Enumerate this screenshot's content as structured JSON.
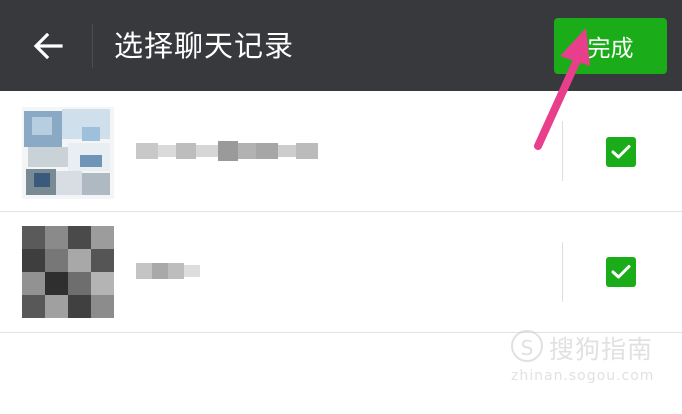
{
  "header": {
    "back_icon": "arrow-left-icon",
    "title": "选择聊天记录",
    "done_label": "完成"
  },
  "chats": [
    {
      "name": "",
      "selected": true
    },
    {
      "name": "",
      "selected": true
    }
  ],
  "watermark": {
    "text": "搜狗指南",
    "url": "zhinan.sogou.com"
  },
  "colors": {
    "header_bg": "#38393d",
    "accent_green": "#1aad19",
    "annotation_arrow": "#e83e8c"
  }
}
